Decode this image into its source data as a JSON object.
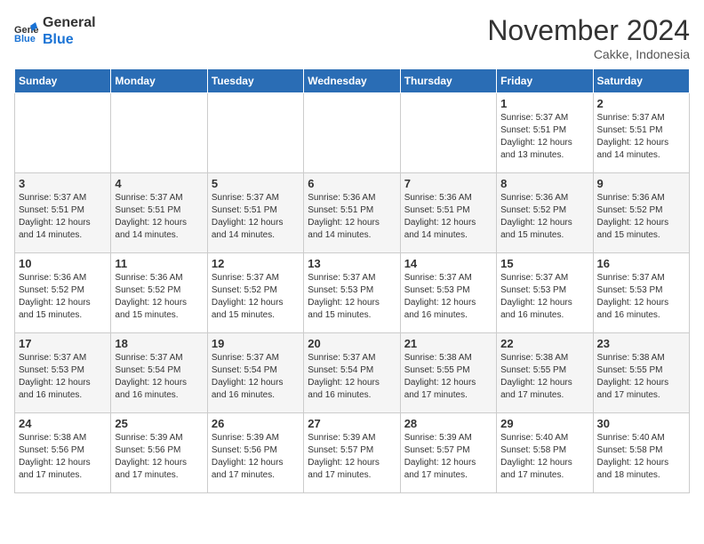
{
  "header": {
    "logo_line1": "General",
    "logo_line2": "Blue",
    "month": "November 2024",
    "location": "Cakke, Indonesia"
  },
  "weekdays": [
    "Sunday",
    "Monday",
    "Tuesday",
    "Wednesday",
    "Thursday",
    "Friday",
    "Saturday"
  ],
  "weeks": [
    [
      {
        "day": "",
        "info": ""
      },
      {
        "day": "",
        "info": ""
      },
      {
        "day": "",
        "info": ""
      },
      {
        "day": "",
        "info": ""
      },
      {
        "day": "",
        "info": ""
      },
      {
        "day": "1",
        "info": "Sunrise: 5:37 AM\nSunset: 5:51 PM\nDaylight: 12 hours\nand 13 minutes."
      },
      {
        "day": "2",
        "info": "Sunrise: 5:37 AM\nSunset: 5:51 PM\nDaylight: 12 hours\nand 14 minutes."
      }
    ],
    [
      {
        "day": "3",
        "info": "Sunrise: 5:37 AM\nSunset: 5:51 PM\nDaylight: 12 hours\nand 14 minutes."
      },
      {
        "day": "4",
        "info": "Sunrise: 5:37 AM\nSunset: 5:51 PM\nDaylight: 12 hours\nand 14 minutes."
      },
      {
        "day": "5",
        "info": "Sunrise: 5:37 AM\nSunset: 5:51 PM\nDaylight: 12 hours\nand 14 minutes."
      },
      {
        "day": "6",
        "info": "Sunrise: 5:36 AM\nSunset: 5:51 PM\nDaylight: 12 hours\nand 14 minutes."
      },
      {
        "day": "7",
        "info": "Sunrise: 5:36 AM\nSunset: 5:51 PM\nDaylight: 12 hours\nand 14 minutes."
      },
      {
        "day": "8",
        "info": "Sunrise: 5:36 AM\nSunset: 5:52 PM\nDaylight: 12 hours\nand 15 minutes."
      },
      {
        "day": "9",
        "info": "Sunrise: 5:36 AM\nSunset: 5:52 PM\nDaylight: 12 hours\nand 15 minutes."
      }
    ],
    [
      {
        "day": "10",
        "info": "Sunrise: 5:36 AM\nSunset: 5:52 PM\nDaylight: 12 hours\nand 15 minutes."
      },
      {
        "day": "11",
        "info": "Sunrise: 5:36 AM\nSunset: 5:52 PM\nDaylight: 12 hours\nand 15 minutes."
      },
      {
        "day": "12",
        "info": "Sunrise: 5:37 AM\nSunset: 5:52 PM\nDaylight: 12 hours\nand 15 minutes."
      },
      {
        "day": "13",
        "info": "Sunrise: 5:37 AM\nSunset: 5:53 PM\nDaylight: 12 hours\nand 15 minutes."
      },
      {
        "day": "14",
        "info": "Sunrise: 5:37 AM\nSunset: 5:53 PM\nDaylight: 12 hours\nand 16 minutes."
      },
      {
        "day": "15",
        "info": "Sunrise: 5:37 AM\nSunset: 5:53 PM\nDaylight: 12 hours\nand 16 minutes."
      },
      {
        "day": "16",
        "info": "Sunrise: 5:37 AM\nSunset: 5:53 PM\nDaylight: 12 hours\nand 16 minutes."
      }
    ],
    [
      {
        "day": "17",
        "info": "Sunrise: 5:37 AM\nSunset: 5:53 PM\nDaylight: 12 hours\nand 16 minutes."
      },
      {
        "day": "18",
        "info": "Sunrise: 5:37 AM\nSunset: 5:54 PM\nDaylight: 12 hours\nand 16 minutes."
      },
      {
        "day": "19",
        "info": "Sunrise: 5:37 AM\nSunset: 5:54 PM\nDaylight: 12 hours\nand 16 minutes."
      },
      {
        "day": "20",
        "info": "Sunrise: 5:37 AM\nSunset: 5:54 PM\nDaylight: 12 hours\nand 16 minutes."
      },
      {
        "day": "21",
        "info": "Sunrise: 5:38 AM\nSunset: 5:55 PM\nDaylight: 12 hours\nand 17 minutes."
      },
      {
        "day": "22",
        "info": "Sunrise: 5:38 AM\nSunset: 5:55 PM\nDaylight: 12 hours\nand 17 minutes."
      },
      {
        "day": "23",
        "info": "Sunrise: 5:38 AM\nSunset: 5:55 PM\nDaylight: 12 hours\nand 17 minutes."
      }
    ],
    [
      {
        "day": "24",
        "info": "Sunrise: 5:38 AM\nSunset: 5:56 PM\nDaylight: 12 hours\nand 17 minutes."
      },
      {
        "day": "25",
        "info": "Sunrise: 5:39 AM\nSunset: 5:56 PM\nDaylight: 12 hours\nand 17 minutes."
      },
      {
        "day": "26",
        "info": "Sunrise: 5:39 AM\nSunset: 5:56 PM\nDaylight: 12 hours\nand 17 minutes."
      },
      {
        "day": "27",
        "info": "Sunrise: 5:39 AM\nSunset: 5:57 PM\nDaylight: 12 hours\nand 17 minutes."
      },
      {
        "day": "28",
        "info": "Sunrise: 5:39 AM\nSunset: 5:57 PM\nDaylight: 12 hours\nand 17 minutes."
      },
      {
        "day": "29",
        "info": "Sunrise: 5:40 AM\nSunset: 5:58 PM\nDaylight: 12 hours\nand 17 minutes."
      },
      {
        "day": "30",
        "info": "Sunrise: 5:40 AM\nSunset: 5:58 PM\nDaylight: 12 hours\nand 18 minutes."
      }
    ]
  ]
}
